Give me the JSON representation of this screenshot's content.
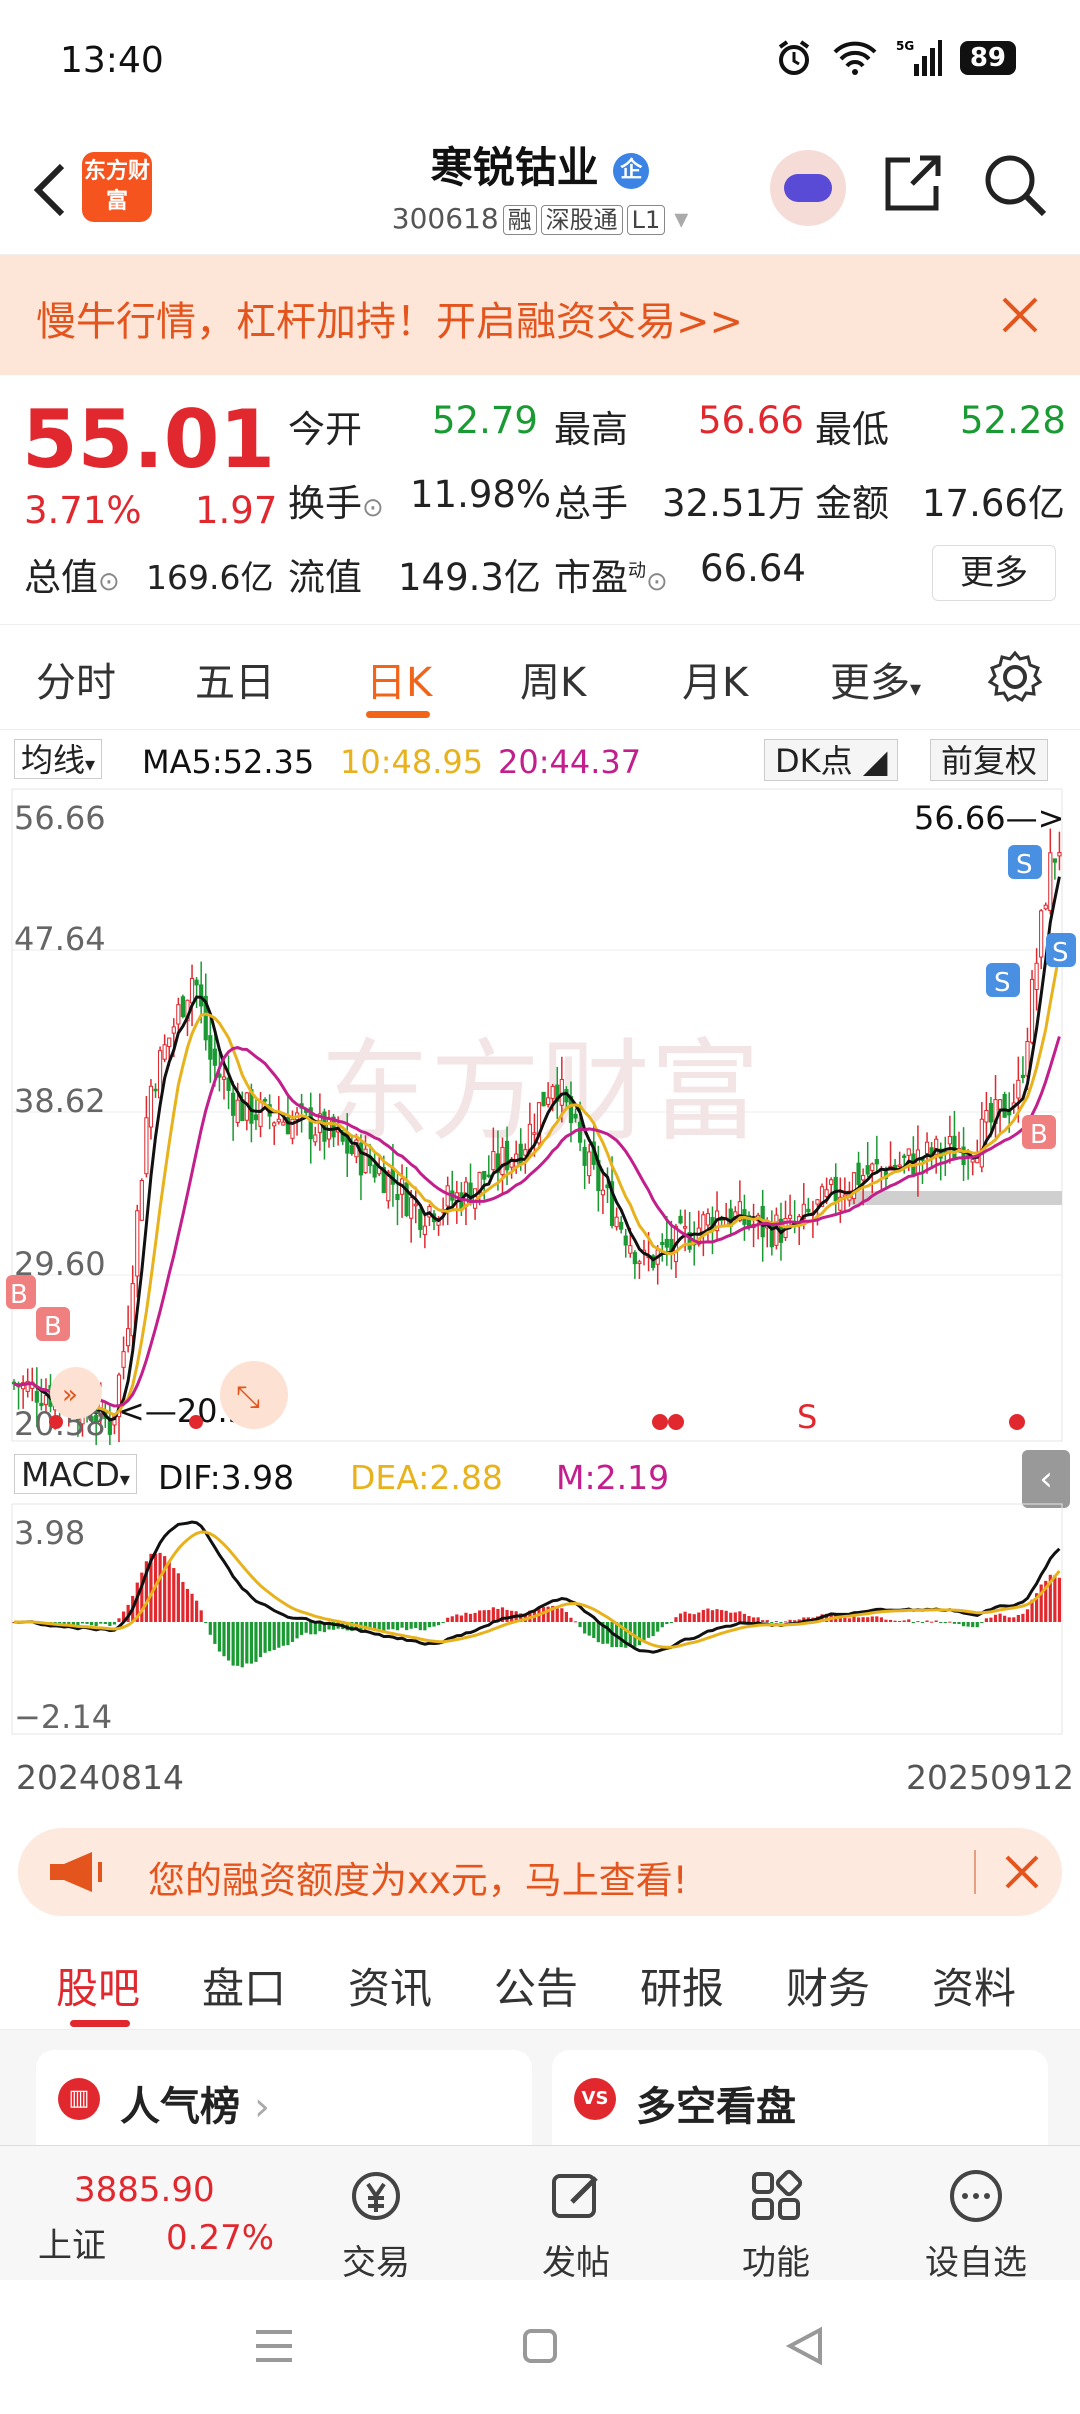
{
  "status_bar": {
    "time": "13:40",
    "battery": "89"
  },
  "header": {
    "title": "寒锐钴业",
    "code": "300618",
    "tags": [
      "融",
      "深股通",
      "L1"
    ],
    "logo_text": "东方财富"
  },
  "banner": {
    "text": "慢牛行情，杠杆加持！开启融资交易>>"
  },
  "quote": {
    "price": "55.01",
    "change_pct": "3.71%",
    "change": "1.97",
    "open_label": "今开",
    "open": "52.79",
    "high_label": "最高",
    "high": "56.66",
    "low_label": "最低",
    "low": "52.28",
    "turnover_label": "换手",
    "turnover": "11.98%",
    "volume_label": "总手",
    "volume": "32.51万",
    "amount_label": "金额",
    "amount": "17.66亿",
    "mcap_label": "总值",
    "mcap": "169.6亿",
    "float_label": "流值",
    "float_cap": "149.3亿",
    "pe_label": "市盈",
    "pe_sup": "动",
    "pe": "66.64",
    "more": "更多"
  },
  "tabs": [
    "分时",
    "五日",
    "日K",
    "周K",
    "月K",
    "更多"
  ],
  "ma_bar": {
    "selector": "均线",
    "ma5": "MA5:52.35",
    "ma10": "10:48.95",
    "ma20": "20:44.37",
    "dk": "DK点",
    "adjust": "前复权"
  },
  "k_axis": {
    "y1": "56.66",
    "y2": "47.64",
    "y3": "38.62",
    "y4": "29.60",
    "y5": "20.58",
    "max_label": "56.66",
    "min_label": "20.58",
    "s_marker": "S",
    "b_marker": "B"
  },
  "macd_bar": {
    "selector": "MACD",
    "dif": "DIF:3.98",
    "dea": "DEA:2.88",
    "m": "M:2.19"
  },
  "macd_axis": {
    "top": "3.98",
    "bottom": "−2.14"
  },
  "dates": {
    "start": "20240814",
    "end": "20250912"
  },
  "notice": {
    "text": "您的融资额度为xx元，马上查看!"
  },
  "bottom_tabs": [
    "股吧",
    "盘口",
    "资讯",
    "公告",
    "研报",
    "财务",
    "资料"
  ],
  "cards": {
    "left": "人气榜",
    "right": "多空看盘"
  },
  "dock": {
    "index_value": "3885.90",
    "index_name": "上证",
    "index_pct": "0.27%",
    "trade": "交易",
    "post": "发帖",
    "func": "功能",
    "watch": "设自选"
  },
  "colors": {
    "up": "#e0282e",
    "down": "#1a9a32",
    "accent": "#f26418",
    "ma5": "#111111",
    "ma10": "#e8b21c",
    "ma20": "#c21e8c"
  }
}
